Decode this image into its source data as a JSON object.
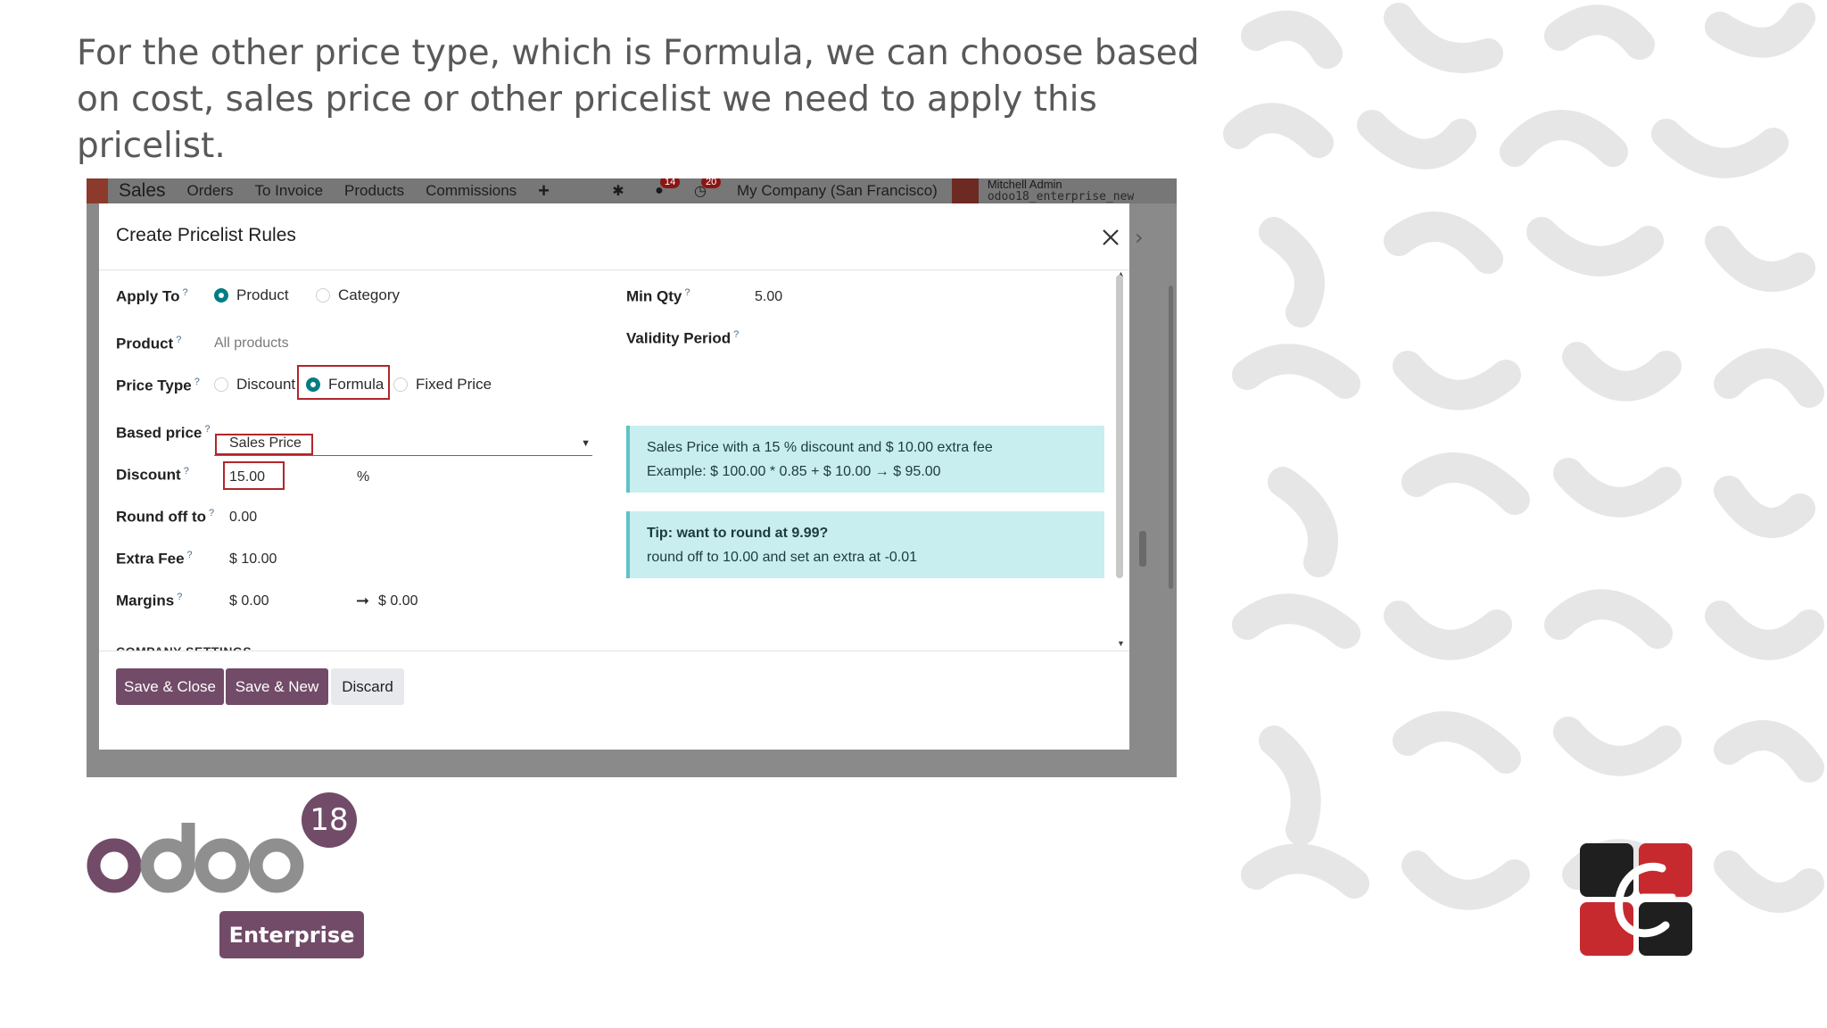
{
  "caption": "For the other price type, which is Formula, we can choose based on cost, sales price or other pricelist we need to apply this pricelist.",
  "topbar": {
    "app": "Sales",
    "menus": [
      "Orders",
      "To Invoice",
      "Products",
      "Commissions"
    ],
    "plus": "+",
    "messages_count": "14",
    "activities_count": "20",
    "company": "My Company (San Francisco)",
    "user": "Mitchell Admin",
    "database": "odoo18_enterprise_new"
  },
  "modal": {
    "title": "Create Pricelist Rules",
    "apply_to": {
      "label": "Apply To",
      "options": [
        "Product",
        "Category"
      ],
      "selected": "Product"
    },
    "product": {
      "label": "Product",
      "placeholder": "All products"
    },
    "price_type": {
      "label": "Price Type",
      "options": [
        "Discount",
        "Formula",
        "Fixed Price"
      ],
      "selected": "Formula"
    },
    "based_price": {
      "label": "Based price",
      "value": "Sales Price"
    },
    "discount": {
      "label": "Discount",
      "value": "15.00",
      "unit": "%"
    },
    "round_off": {
      "label": "Round off to",
      "value": "0.00"
    },
    "extra_fee": {
      "label": "Extra Fee",
      "value": "$ 10.00"
    },
    "margins": {
      "label": "Margins",
      "min": "$ 0.00",
      "arrow": "➞",
      "max": "$ 0.00"
    },
    "min_qty": {
      "label": "Min Qty",
      "value": "5.00"
    },
    "validity": {
      "label": "Validity Period"
    },
    "info_example": {
      "line1": "Sales Price with a 15 % discount and $ 10.00 extra fee",
      "line2": "Example: $ 100.00 * 0.85 + $ 10.00 → $ 95.00"
    },
    "info_tip": {
      "line1": "Tip: want to round at 9.99?",
      "line2": "round off to 10.00 and set an extra at -0.01"
    },
    "section": "COMPANY SETTINGS",
    "buttons": {
      "save_close": "Save & Close",
      "save_new": "Save & New",
      "discard": "Discard"
    }
  },
  "logo": {
    "version": "18",
    "edition": "Enterprise"
  },
  "colors": {
    "brand": "#714b67",
    "accent": "#017e84",
    "highlight": "#b0262b",
    "info_bg": "#c9eef0"
  }
}
